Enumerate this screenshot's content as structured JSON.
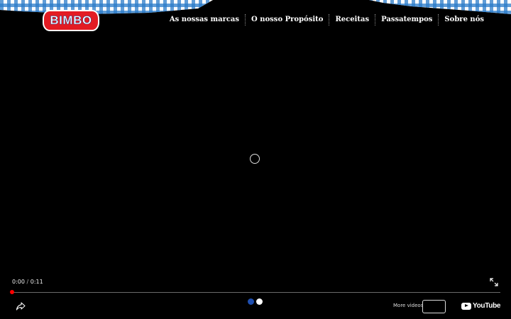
{
  "header": {
    "logo_text": "BIMBO",
    "nav": [
      {
        "label": "As nossas marcas"
      },
      {
        "label": "O nosso Propósito"
      },
      {
        "label": "Receitas"
      },
      {
        "label": "Passatempos"
      },
      {
        "label": "Sobre nós"
      }
    ]
  },
  "player": {
    "current_time": "0:00",
    "separator": " / ",
    "duration": "0:11",
    "progress": 0,
    "more_videos_label": "More videos",
    "youtube_label": "YouTube",
    "icons": {
      "fullscreen": "fullscreen-icon",
      "share": "share-icon",
      "loading": "loading-spinner-icon"
    },
    "dots": [
      {
        "color": "#1f4fb0"
      },
      {
        "color": "#ffffff"
      }
    ]
  },
  "colors": {
    "brand_red": "#e31b23",
    "gingham_blue": "#2a7bc8",
    "progress_red": "#ff0000"
  }
}
